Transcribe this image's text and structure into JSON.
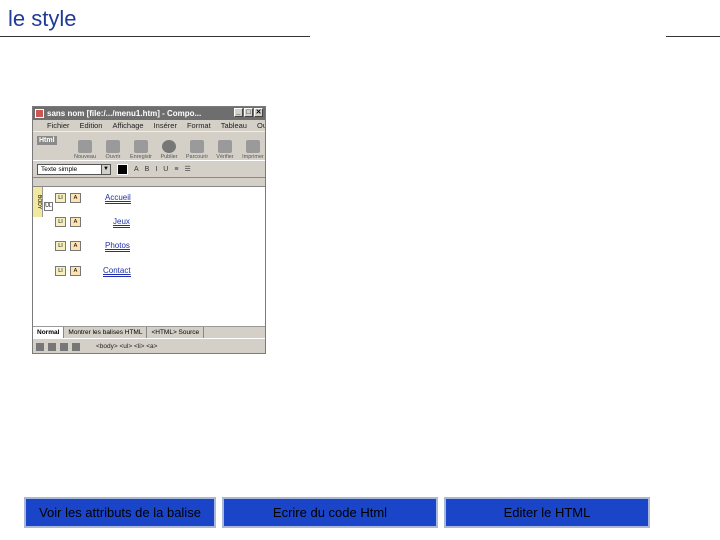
{
  "slide": {
    "title": "le style"
  },
  "window": {
    "title": "sans nom [file:/.../menu1.htm] - Compo...",
    "min_label": "_",
    "max_label": "□",
    "close_label": "✕",
    "badge": "Html",
    "menus": [
      "Fichier",
      "Edition",
      "Affichage",
      "Insérer",
      "Format",
      "Tableau",
      "Outils"
    ],
    "toolbar": [
      "Nouveau",
      "Ouvrir",
      "Enregistr",
      "Publier",
      "Parcourir",
      "Vérifier",
      "Imprimer"
    ],
    "style_select": "Texte simple",
    "menu_items": [
      "Accueil",
      "Jeux",
      "Photos",
      "Contact"
    ],
    "tag_li": "LI",
    "tag_a": "A",
    "tag_ul": "UL",
    "gutter": "BODY",
    "tabs": [
      "Normal",
      "Montrer les balises HTML",
      "<HTML> Source"
    ],
    "status_path": "<body> <ul> <li> <a>"
  },
  "buttons": {
    "attributes": "Voir les attributs de la balise",
    "write_code": "Ecrire du code Html",
    "edit_html": "Editer le HTML"
  }
}
